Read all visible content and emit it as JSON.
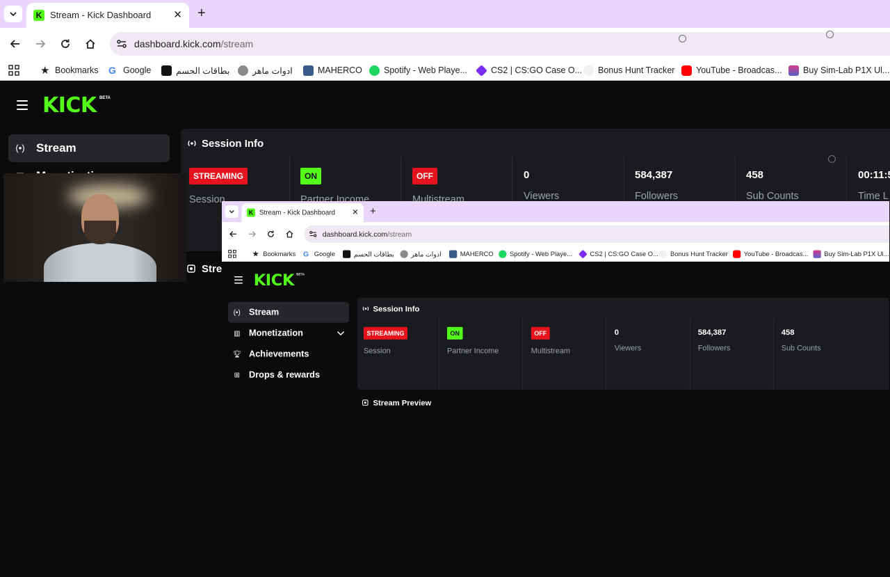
{
  "browser": {
    "tab": {
      "title": "Stream - Kick Dashboard",
      "favicon": "K"
    },
    "url": {
      "host": "dashboard.kick.com",
      "path": "/stream"
    },
    "bookmarks": [
      {
        "label": "Bookmarks",
        "icon": "star-icon"
      },
      {
        "label": "Google",
        "icon": "google-icon"
      },
      {
        "label": "بطاقات الحسم",
        "icon": "cards-icon"
      },
      {
        "label": "ادوات ماهر",
        "icon": "alien-icon"
      },
      {
        "label": "MAHERCO",
        "icon": "maherco-icon"
      },
      {
        "label": "Spotify - Web Playe...",
        "icon": "spotify-icon"
      },
      {
        "label": "CS2 | CS:GO Case O...",
        "icon": "case-icon"
      },
      {
        "label": "Bonus Hunt Tracker",
        "icon": "tracker-icon"
      },
      {
        "label": "YouTube - Broadcas...",
        "icon": "youtube-icon"
      },
      {
        "label": "Buy Sim-Lab P1X Ul...",
        "icon": "simlab-icon"
      }
    ]
  },
  "kick": {
    "logo": "KICK",
    "beta": "BETA",
    "nav": [
      {
        "label": "Stream",
        "icon": "live-icon",
        "active": true
      },
      {
        "label": "Monetization",
        "icon": "chart-icon",
        "active": false
      },
      {
        "label": "Achievements",
        "icon": "trophy-icon",
        "active": false
      },
      {
        "label": "Drops & rewards",
        "icon": "gift-icon",
        "active": false
      }
    ],
    "session_info": {
      "title": "Session Info",
      "cells": [
        {
          "badge": "STREAMING",
          "label": "Session"
        },
        {
          "badge": "ON",
          "label": "Partner Income"
        },
        {
          "badge": "OFF",
          "label": "Multistream"
        },
        {
          "value": "0",
          "label": "Viewers"
        },
        {
          "value": "584,387",
          "label": "Followers"
        },
        {
          "value": "458",
          "label": "Sub Counts"
        },
        {
          "value": "00:11:5",
          "label": "Time L"
        }
      ]
    },
    "stream_preview": {
      "title": "Stream Preview"
    }
  },
  "colors": {
    "kick_green": "#53fc18",
    "live_red": "#e6131f",
    "card_bg": "#191b1f",
    "tabbar": "#ead6fb"
  }
}
